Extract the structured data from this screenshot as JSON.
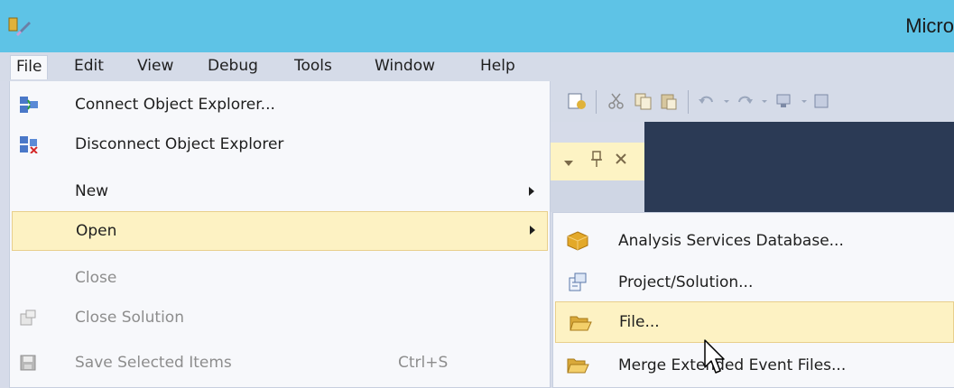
{
  "window": {
    "title": "Micro"
  },
  "menubar": {
    "items": [
      {
        "label": "File"
      },
      {
        "label": "Edit"
      },
      {
        "label": "View"
      },
      {
        "label": "Debug"
      },
      {
        "label": "Tools"
      },
      {
        "label": "Window"
      },
      {
        "label": "Help"
      }
    ]
  },
  "file_menu": {
    "items": [
      {
        "label": "Connect Object Explorer...",
        "icon": "connect-object-explorer-icon"
      },
      {
        "label": "Disconnect Object Explorer",
        "icon": "disconnect-object-explorer-icon"
      },
      {
        "label": "New"
      },
      {
        "label": "Open",
        "highlighted": true
      },
      {
        "label": "Close",
        "disabled": true
      },
      {
        "label": "Close Solution",
        "disabled": true,
        "icon": "close-solution-icon"
      },
      {
        "label": "Save Selected Items",
        "disabled": true,
        "shortcut": "Ctrl+S",
        "icon": "save-icon"
      }
    ]
  },
  "open_submenu": {
    "items": [
      {
        "label": "Analysis Services Database...",
        "icon": "analysis-database-icon"
      },
      {
        "label": "Project/Solution...",
        "icon": "project-solution-icon"
      },
      {
        "label": "File...",
        "icon": "open-folder-icon",
        "highlighted": true
      },
      {
        "label": "Merge Extended Event Files...",
        "icon": "open-folder-icon"
      }
    ]
  },
  "colors": {
    "titlebar": "#5ec3e6",
    "menubar": "#d5dbe8",
    "menu_background": "#f7f8fb",
    "highlight": "#fdf2c3",
    "highlight_border": "#e8cf8c",
    "disabled_text": "#8d8d8d",
    "dark_panel": "#2b3a55"
  }
}
